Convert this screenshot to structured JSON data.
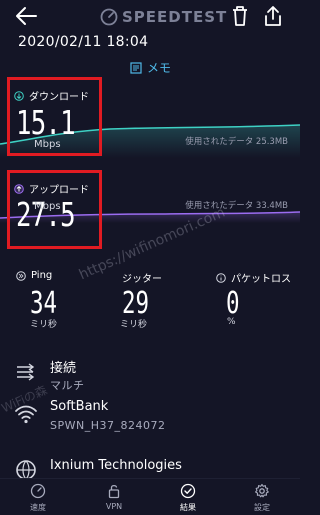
{
  "header": {
    "app_name": "SPEEDTEST"
  },
  "result": {
    "datetime": "2020/02/11 18:04",
    "memo_label": "メモ"
  },
  "download": {
    "label": "ダウンロード",
    "value": "15.1",
    "unit": "Mbps",
    "data_used": "使用されたデータ 25.3MB"
  },
  "upload": {
    "label": "アップロード",
    "value": "27.5",
    "unit": "Mbps",
    "data_used": "使用されたデータ 33.4MB"
  },
  "metrics": {
    "ping": {
      "label": "Ping",
      "value": "34",
      "unit": "ミリ秒"
    },
    "jitter": {
      "label": "ジッター",
      "value": "29",
      "unit": "ミリ秒"
    },
    "packet_loss": {
      "label": "パケットロス",
      "value": "0",
      "unit": "%"
    }
  },
  "connection": {
    "title": "接続",
    "type": "マルチ"
  },
  "carrier": {
    "name": "SoftBank",
    "detail": "SPWN_H37_824072"
  },
  "server": {
    "name": "Ixnium Technologies"
  },
  "watermark": {
    "text": "https://wifinomori.com",
    "site_name": "WiFiの森"
  },
  "bottom_nav": {
    "speed": "速度",
    "vpn": "VPN",
    "results": "結果",
    "settings": "設定"
  },
  "colors": {
    "background": "#141526",
    "download_accent": "#3ed1c4",
    "upload_accent": "#9b6cf0",
    "highlight_box": "#e11b22",
    "memo_link": "#4fb9e8"
  }
}
